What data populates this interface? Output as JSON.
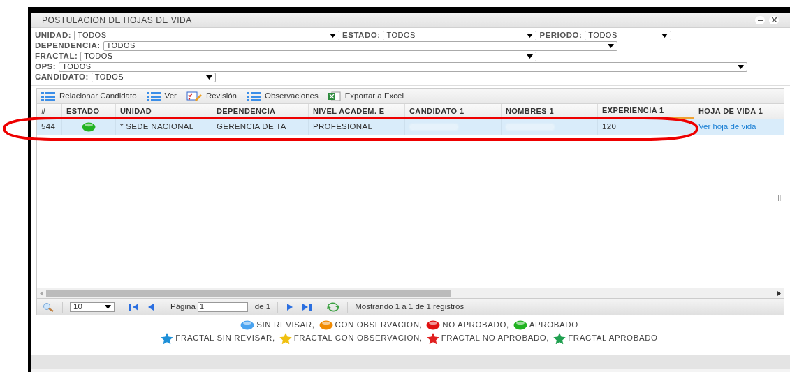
{
  "window": {
    "title": "POSTULACION DE HOJAS DE VIDA"
  },
  "filters": [
    [
      {
        "label": "UNIDAD:",
        "value": "TODOS"
      },
      {
        "label": "ESTADO:",
        "value": "TODOS"
      },
      {
        "label": "PERIODO:",
        "value": "TODOS"
      }
    ],
    [
      {
        "label": "DEPENDENCIA:",
        "value": "TODOS"
      }
    ],
    [
      {
        "label": "FRACTAL:",
        "value": "TODOS"
      }
    ],
    [
      {
        "label": "OPS:",
        "value": "TODOS"
      }
    ],
    [
      {
        "label": "CANDIDATO:",
        "value": "TODOS"
      }
    ]
  ],
  "toolbar": [
    {
      "label": "Relacionar Candidato",
      "kind": "list"
    },
    {
      "label": "Ver",
      "kind": "list"
    },
    {
      "label": "Revisión",
      "kind": "review"
    },
    {
      "label": "Observaciones",
      "kind": "list"
    },
    {
      "label": "Exportar a Excel",
      "kind": "excel"
    }
  ],
  "table": {
    "columns": [
      {
        "label": "#",
        "sorted": false
      },
      {
        "label": "ESTADO",
        "sorted": false
      },
      {
        "label": "UNIDAD",
        "sorted": false
      },
      {
        "label": "DEPENDENCIA",
        "sorted": false
      },
      {
        "label": "NIVEL ACADEM. E",
        "sorted": false
      },
      {
        "label": "CANDIDATO 1",
        "sorted": false
      },
      {
        "label": "NOMBRES 1",
        "sorted": false
      },
      {
        "label": "EXPERIENCIA 1",
        "sorted": true
      },
      {
        "label": "HOJA DE VIDA 1",
        "sorted": false
      }
    ],
    "rows": [
      {
        "selected": true,
        "cells": [
          {
            "kind": "text",
            "text": "544"
          },
          {
            "kind": "status",
            "color": "#22b322"
          },
          {
            "kind": "text",
            "text": "* SEDE NACIONAL"
          },
          {
            "kind": "text",
            "text": "GERENCIA DE TA"
          },
          {
            "kind": "text",
            "text": "PROFESIONAL"
          },
          {
            "kind": "blurred"
          },
          {
            "kind": "blurred"
          },
          {
            "kind": "text",
            "text": "120"
          },
          {
            "kind": "link",
            "text": "Ver hoja de vida"
          }
        ]
      }
    ]
  },
  "pager": {
    "page_size": "10",
    "page_label": "Página",
    "page": "1",
    "of": "de 1",
    "info": "Mostrando 1 a 1 de 1 registros"
  },
  "legend": [
    [
      {
        "kind": "circle",
        "color": "#4aa3f0",
        "label": "SIN REVISAR,"
      },
      {
        "kind": "circle",
        "color": "#f08a00",
        "label": "CON OBSERVACION,"
      },
      {
        "kind": "circle",
        "color": "#e01010",
        "label": "NO APROBADO,"
      },
      {
        "kind": "circle",
        "color": "#22b322",
        "label": "APROBADO"
      }
    ],
    [
      {
        "kind": "star",
        "color": "#1e90d8",
        "label": "FRACTAL SIN REVISAR,"
      },
      {
        "kind": "star",
        "color": "#f0c010",
        "label": "FRACTAL CON OBSERVACION,"
      },
      {
        "kind": "star",
        "color": "#e02020",
        "label": "FRACTAL NO APROBADO,"
      },
      {
        "kind": "star",
        "color": "#20a050",
        "label": "FRACTAL APROBADO"
      }
    ]
  ]
}
